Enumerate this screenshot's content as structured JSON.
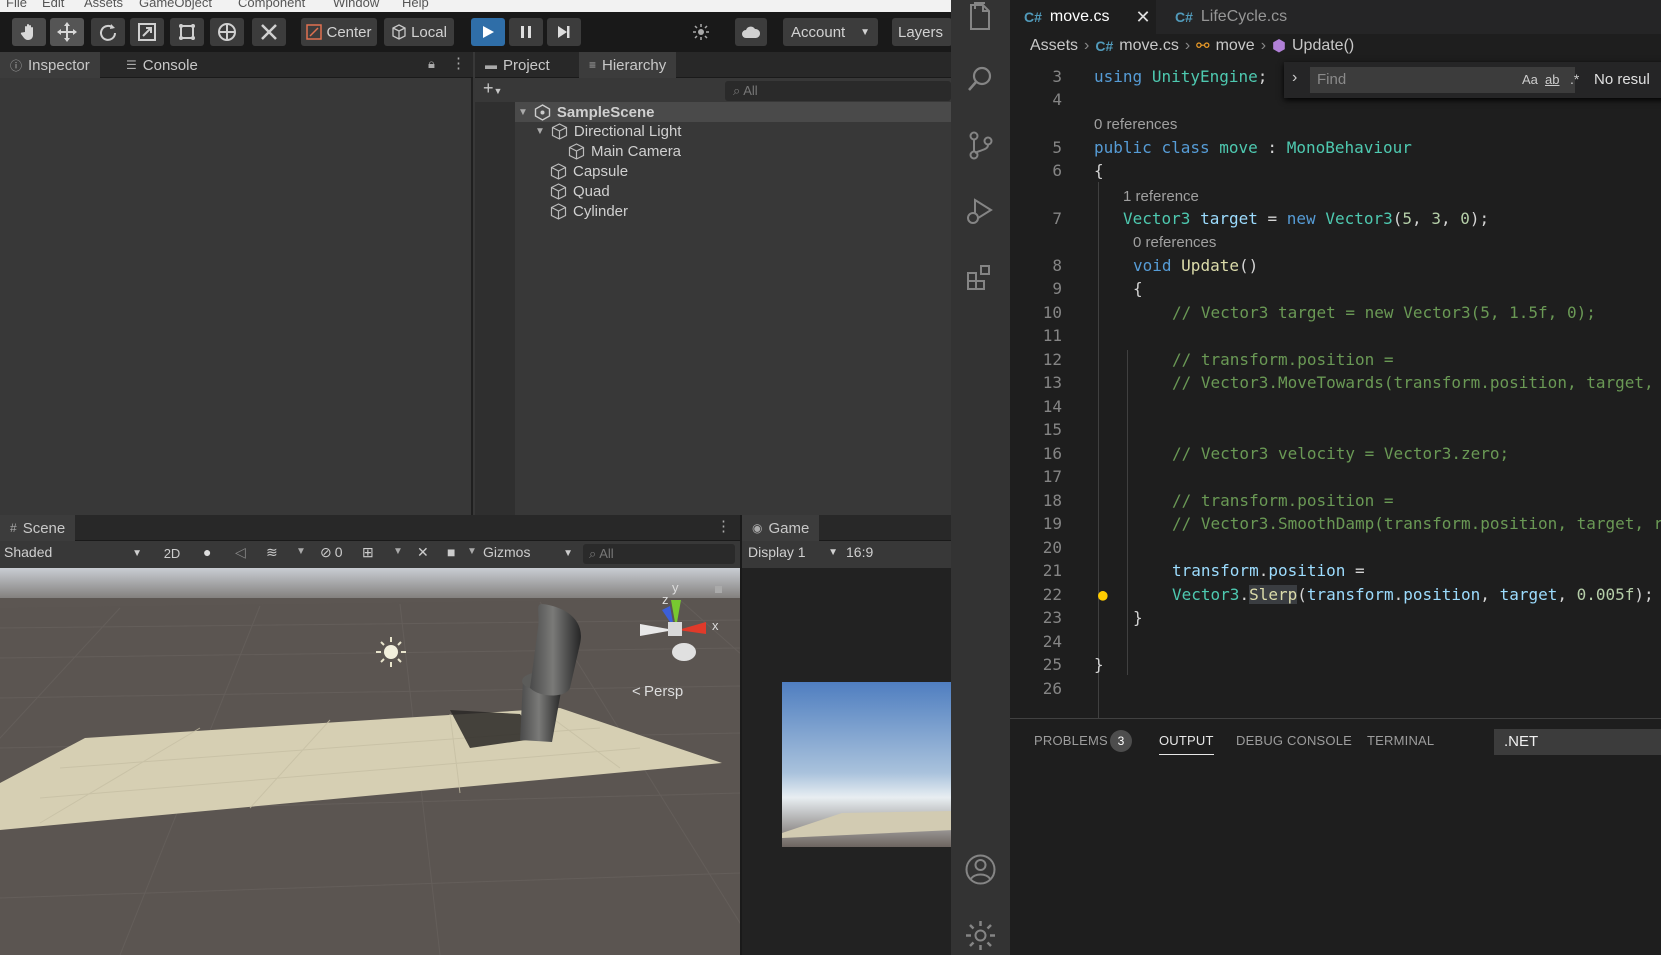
{
  "unity": {
    "menu": [
      "File",
      "Edit",
      "Assets",
      "GameObject",
      "Component",
      "Window",
      "Help"
    ],
    "toolbar": {
      "pivot_label": "Center",
      "space_label": "Local",
      "account_label": "Account",
      "layers_label": "Layers",
      "icons": [
        "hand-icon",
        "move-icon",
        "rotate-icon",
        "scale-icon",
        "rect-icon",
        "transform-icon",
        "custom-tool-icon"
      ]
    },
    "inspector_tabs": [
      "Inspector",
      "Console"
    ],
    "project_tabs": [
      "Project",
      "Hierarchy"
    ],
    "hierarchy": {
      "search_placeholder": "All",
      "scene": "SampleScene",
      "items": [
        {
          "label": "Directional Light",
          "depth": 1
        },
        {
          "label": "Main Camera",
          "depth": 2
        },
        {
          "label": "Capsule",
          "depth": 1
        },
        {
          "label": "Quad",
          "depth": 1
        },
        {
          "label": "Cylinder",
          "depth": 1
        }
      ]
    },
    "scene_panel": {
      "tab": "Scene",
      "shading": "Shaded",
      "mode_2d": "2D",
      "hidden_count": "0",
      "gizmos": "Gizmos",
      "search_placeholder": "All",
      "persp": "Persp",
      "axis_x": "x",
      "axis_y": "y",
      "axis_z": "z"
    },
    "game_panel": {
      "tab": "Game",
      "display": "Display 1",
      "aspect": "16:9"
    }
  },
  "vscode": {
    "tabs": [
      {
        "label": "move.cs",
        "active": true
      },
      {
        "label": "LifeCycle.cs",
        "active": false
      }
    ],
    "breadcrumb": [
      "Assets",
      "move.cs",
      "move",
      "Update()"
    ],
    "find": {
      "placeholder": "Find",
      "result": "No resul",
      "opt_case": "Aa",
      "opt_word": "ab",
      "opt_regex": ".*"
    },
    "code": {
      "lines": [
        {
          "n": "3"
        },
        {
          "n": "4"
        },
        {
          "n": "5"
        },
        {
          "n": "6"
        },
        {
          "n": "7"
        },
        {
          "n": "8"
        },
        {
          "n": "9"
        },
        {
          "n": "10"
        },
        {
          "n": "11"
        },
        {
          "n": "12"
        },
        {
          "n": "13"
        },
        {
          "n": "14"
        },
        {
          "n": "15"
        },
        {
          "n": "16"
        },
        {
          "n": "17"
        },
        {
          "n": "18"
        },
        {
          "n": "19"
        },
        {
          "n": "20"
        },
        {
          "n": "21"
        },
        {
          "n": "22"
        },
        {
          "n": "23"
        },
        {
          "n": "24"
        },
        {
          "n": "25"
        },
        {
          "n": "26"
        }
      ],
      "codelens": {
        "class_refs": "0 references",
        "target_refs": "1 reference",
        "update_refs": "0 references"
      },
      "text": {
        "using_kw": "using",
        "using_ns": "UnityEngine",
        "semi": ";",
        "public_kw": "public",
        "class_kw": "class",
        "class_name": "move",
        "colon": " : ",
        "base": "MonoBehaviour",
        "brace_open": "{",
        "brace_close": "}",
        "vec3": "Vector3",
        "target": "target",
        "eq": " = ",
        "new_kw": "new",
        "vec_args_open": "(",
        "n5": "5",
        "comma": ", ",
        "n3": "3",
        "n0": "0",
        "close_semi": ");",
        "void_kw": "void",
        "update": "Update",
        "parens": "()",
        "c10": "// Vector3 target = new Vector3(5, 1.5f, 0);",
        "c12": "// transform.position =",
        "c13": "// Vector3.MoveTowards(transform.position, target,",
        "c16": "// Vector3 velocity = Vector3.zero;",
        "c18": "// transform.position =",
        "c19": "// Vector3.SmoothDamp(transform.position, target, r",
        "transform": "transform",
        "dot": ".",
        "position": "position",
        "eq_end": " =",
        "slerp": "Slerp",
        "open": "(",
        "speed": "0.005f"
      }
    },
    "panel_tabs": {
      "problems": "PROBLEMS",
      "problems_count": "3",
      "output": "OUTPUT",
      "debug": "DEBUG CONSOLE",
      "terminal": "TERMINAL",
      "channel": ".NET"
    }
  },
  "colors": {
    "unity_bg": "#383838",
    "play_blue": "#2f6ea8",
    "vscode_bg": "#1e1e1e",
    "keyword": "#569cd6",
    "type": "#4ec9b0",
    "comment": "#6a9955"
  }
}
